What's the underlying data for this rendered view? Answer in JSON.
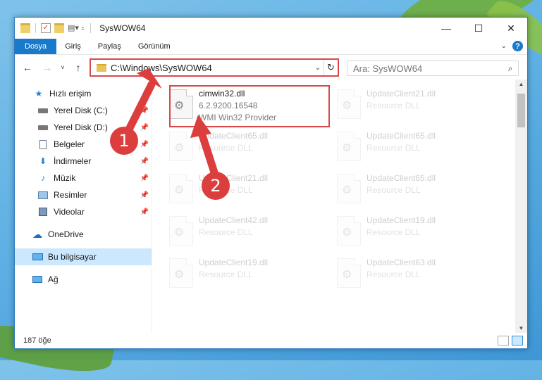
{
  "window": {
    "title": "SysWOW64",
    "controls": [
      "—",
      "☐",
      "✕"
    ]
  },
  "ribbon": {
    "tabs": [
      "Dosya",
      "Giriş",
      "Paylaş",
      "Görünüm"
    ]
  },
  "navbar": {
    "address": "C:\\Windows\\SysWOW64",
    "search_placeholder": "Ara: SysWOW64"
  },
  "sidebar": {
    "items": [
      {
        "label": "Hızlı erişim",
        "icon": "star-icon",
        "pinned": false
      },
      {
        "label": "Yerel Disk (C:)",
        "icon": "drive-icon",
        "pinned": true
      },
      {
        "label": "Yerel Disk (D:)",
        "icon": "drive-icon",
        "pinned": true
      },
      {
        "label": "Belgeler",
        "icon": "document-icon",
        "pinned": true
      },
      {
        "label": "İndirmeler",
        "icon": "download-icon",
        "pinned": true
      },
      {
        "label": "Müzik",
        "icon": "music-icon",
        "pinned": true
      },
      {
        "label": "Resimler",
        "icon": "picture-icon",
        "pinned": true
      },
      {
        "label": "Videolar",
        "icon": "video-icon",
        "pinned": true
      },
      {
        "label": "OneDrive",
        "icon": "cloud-icon",
        "pinned": false
      },
      {
        "label": "Bu bilgisayar",
        "icon": "computer-icon",
        "pinned": false,
        "selected": true
      },
      {
        "label": "Ağ",
        "icon": "network-icon",
        "pinned": false
      }
    ]
  },
  "files": [
    {
      "name": "cimwin32.dll",
      "line2": "6.2.9200.16548",
      "line3": "WMI Win32 Provider"
    },
    {
      "name": "UpdateClient21.dll",
      "line2": "Resource DLL"
    },
    {
      "name": "UpdateClient65.dll",
      "line2": "Resource DLL"
    },
    {
      "name": "UpdateClient65.dll",
      "line2": "Resource DLL"
    },
    {
      "name": "UpdateClient21.dll",
      "line2": "Resource DLL"
    },
    {
      "name": "UpdateClient65.dll",
      "line2": "Resource DLL"
    },
    {
      "name": "UpdateClient42.dll",
      "line2": "Resource DLL"
    },
    {
      "name": "UpdateClient19.dll",
      "line2": "Resource DLL"
    },
    {
      "name": "UpdateClient19.dll",
      "line2": "Resource DLL"
    },
    {
      "name": "UpdateClient63.dll",
      "line2": "Resource DLL"
    }
  ],
  "status": {
    "count": "187 öğe"
  },
  "annotations": {
    "badge1": "1",
    "badge2": "2",
    "color": "#dc3d3d"
  }
}
